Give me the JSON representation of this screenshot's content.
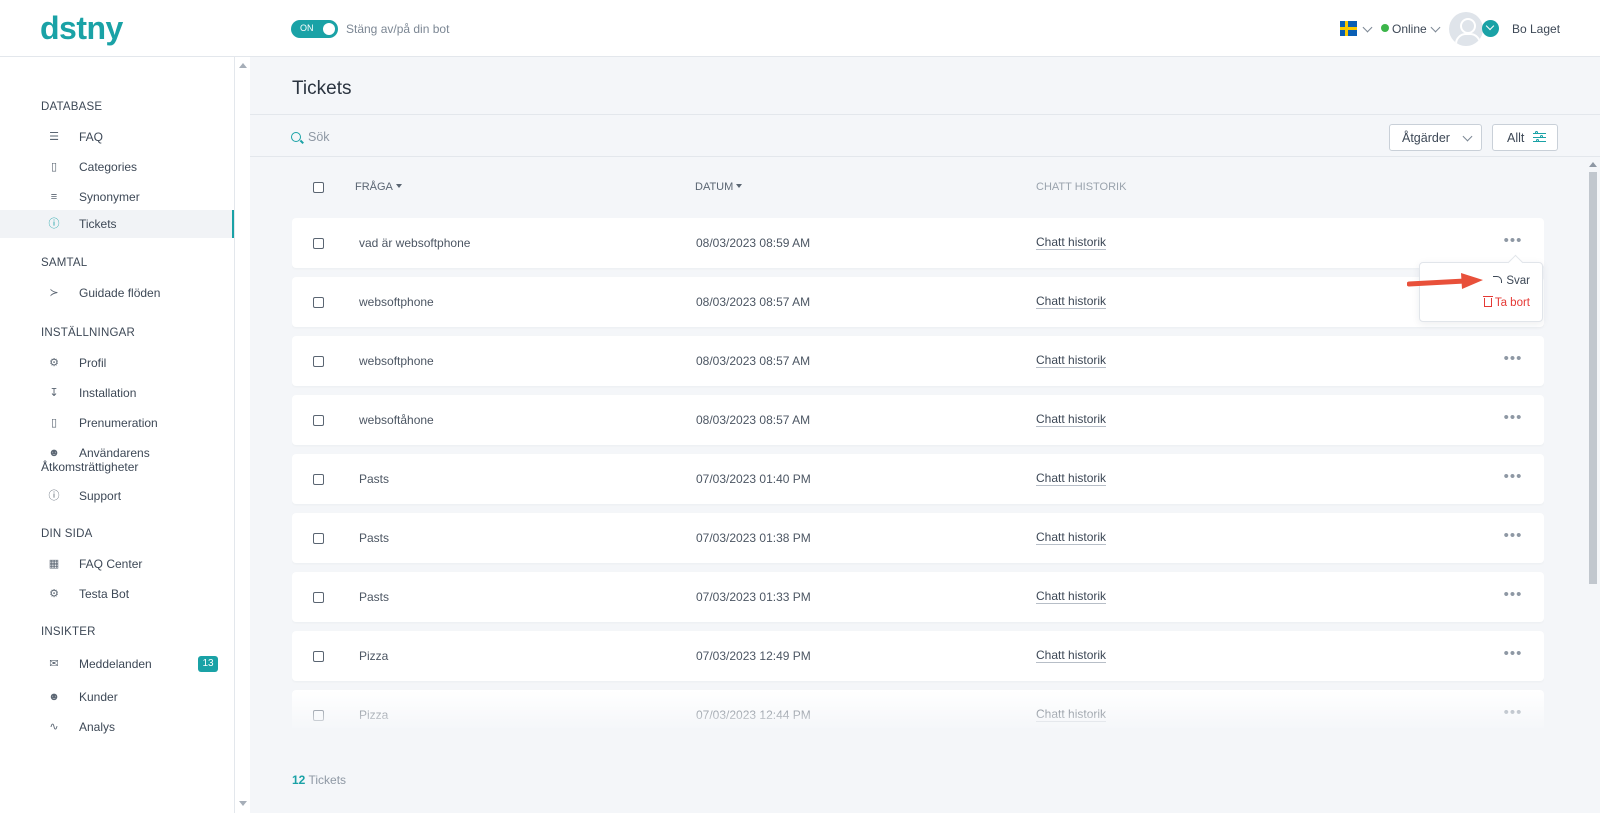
{
  "app": {
    "logo": "dstny"
  },
  "topbar": {
    "toggle_state": "ON",
    "toggle_text": "Stäng av/på din bot",
    "language_flag": "sweden-flag-icon",
    "status": "Online",
    "status_color": "#3cb54a",
    "username": "Bo Laget"
  },
  "sidebar": {
    "sections": [
      {
        "title": "DATABASE",
        "items": [
          {
            "label": "FAQ",
            "icon": "layers-icon"
          },
          {
            "label": "Categories",
            "icon": "clipboard-icon"
          },
          {
            "label": "Synonymer",
            "icon": "strikethrough-icon"
          },
          {
            "label": "Tickets",
            "icon": "help-circle-icon",
            "active": true
          }
        ]
      },
      {
        "title": "SAMTAL",
        "items": [
          {
            "label": "Guidade flöden",
            "icon": "share-icon"
          }
        ]
      },
      {
        "title": "INSTÄLLNINGAR",
        "items": [
          {
            "label": "Profil",
            "icon": "gear-icon"
          },
          {
            "label": "Installation",
            "icon": "download-icon"
          },
          {
            "label": "Prenumeration",
            "icon": "clipboard-icon"
          },
          {
            "label": "Användarens",
            "label2": "Åtkomsträttigheter",
            "icon": "users-icon"
          },
          {
            "label": "Support",
            "icon": "info-icon"
          }
        ]
      },
      {
        "title": "DIN SIDA",
        "items": [
          {
            "label": "FAQ Center",
            "icon": "grid-icon"
          },
          {
            "label": "Testa Bot",
            "icon": "cogs-icon"
          }
        ]
      },
      {
        "title": "INSIKTER",
        "items": [
          {
            "label": "Meddelanden",
            "icon": "messages-icon",
            "badge": "13"
          },
          {
            "label": "Kunder",
            "icon": "users-icon"
          },
          {
            "label": "Analys",
            "icon": "activity-icon"
          }
        ]
      }
    ]
  },
  "main": {
    "title": "Tickets",
    "search_placeholder": "Sök",
    "actions_label": "Åtgärder",
    "filter_label": "Allt",
    "columns": {
      "question": "FRÅGA",
      "date": "DATUM",
      "history": "CHATT HISTORIK"
    },
    "rows": [
      {
        "question": "vad är websoftphone",
        "date": "08/03/2023 08:59 AM",
        "history": "Chatt historik"
      },
      {
        "question": "websoftphone",
        "date": "08/03/2023 08:57 AM",
        "history": "Chatt historik"
      },
      {
        "question": "websoftphone",
        "date": "08/03/2023 08:57 AM",
        "history": "Chatt historik"
      },
      {
        "question": "websoftåhone",
        "date": "08/03/2023 08:57 AM",
        "history": "Chatt historik"
      },
      {
        "question": "Pasts",
        "date": "07/03/2023 01:40 PM",
        "history": "Chatt historik"
      },
      {
        "question": "Pasts",
        "date": "07/03/2023 01:38 PM",
        "history": "Chatt historik"
      },
      {
        "question": "Pasts",
        "date": "07/03/2023 01:33 PM",
        "history": "Chatt historik"
      },
      {
        "question": "Pizza",
        "date": "07/03/2023 12:49 PM",
        "history": "Chatt historik"
      },
      {
        "question": "Pizza",
        "date": "07/03/2023 12:44 PM",
        "history": "Chatt historik"
      }
    ],
    "row_menu": {
      "reply": "Svar",
      "delete": "Ta bort"
    },
    "footer": {
      "count": "12",
      "label": "Tickets"
    }
  },
  "colors": {
    "accent": "#1aa2a6",
    "danger": "#e53935",
    "annotation_arrow": "#e8503a"
  }
}
